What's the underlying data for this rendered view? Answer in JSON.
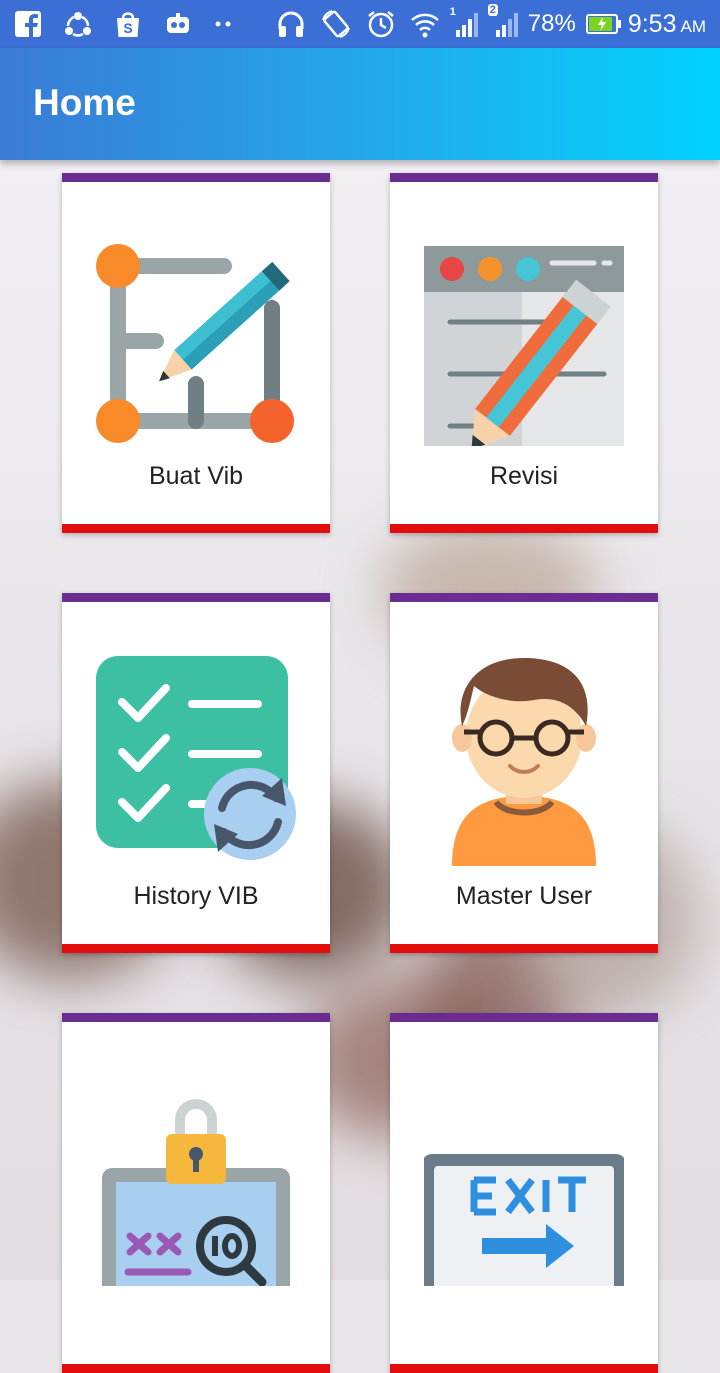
{
  "status_bar": {
    "left_icons": [
      "facebook-icon",
      "share-icon",
      "shopee-icon",
      "bot-icon",
      "dots-icon"
    ],
    "right_icons": [
      "headphones-icon",
      "rotate-icon",
      "alarm-icon",
      "wifi-icon",
      "signal-1-icon",
      "signal-2-icon"
    ],
    "sim1": "1",
    "sim2": "2",
    "battery": "78%",
    "time": "9:53",
    "ampm": "AM"
  },
  "appbar": {
    "title": "Home"
  },
  "menu": [
    {
      "label": "Buat Vib",
      "icon": "edit-diagram-icon"
    },
    {
      "label": "Revisi",
      "icon": "edit-document-icon"
    },
    {
      "label": "History VIB",
      "icon": "checklist-sync-icon"
    },
    {
      "label": "Master User",
      "icon": "user-avatar-icon"
    },
    {
      "label": "",
      "icon": "laptop-security-icon"
    },
    {
      "label": "",
      "icon": "exit-sign-icon"
    }
  ],
  "colors": {
    "accent_top": "#6a2c91",
    "accent_bottom": "#e30d0d",
    "appbar_start": "#3a7bd5",
    "appbar_end": "#00d2ff"
  }
}
